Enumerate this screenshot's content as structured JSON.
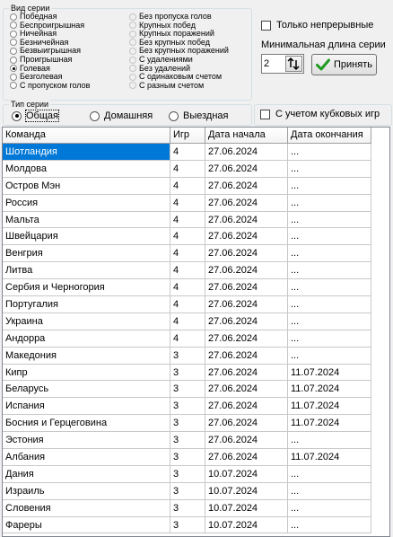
{
  "series_kind": {
    "title": "Вид серии",
    "left_options": [
      {
        "label": "Победная",
        "selected": false
      },
      {
        "label": "Беспроигрышная",
        "selected": false
      },
      {
        "label": "Ничейная",
        "selected": false
      },
      {
        "label": "Безничейная",
        "selected": false
      },
      {
        "label": "Безвыигрышная",
        "selected": false
      },
      {
        "label": "Проигрышная",
        "selected": false
      },
      {
        "label": "Голевая",
        "selected": true
      },
      {
        "label": "Безголевая",
        "selected": false
      },
      {
        "label": "С пропуском голов",
        "selected": false
      }
    ],
    "right_options": [
      {
        "label": "Без пропуска голов",
        "selected": false
      },
      {
        "label": "Крупных побед",
        "selected": false
      },
      {
        "label": "Крупных поражений",
        "selected": false
      },
      {
        "label": "Без крупных побед",
        "selected": false
      },
      {
        "label": "Без крупных поражений",
        "selected": false
      },
      {
        "label": "С удалениями",
        "selected": false
      },
      {
        "label": "Без удалений",
        "selected": false
      },
      {
        "label": "С одинаковым счетом",
        "selected": false
      },
      {
        "label": "С разным счетом",
        "selected": false
      }
    ]
  },
  "continuous_only": {
    "label": "Только непрерывные",
    "checked": false
  },
  "min_length": {
    "label": "Минимальная длина серии",
    "value": "2"
  },
  "accept_button": {
    "label": "Принять",
    "icon": "green-checkmark-icon",
    "icon_color": "#1f9a1f"
  },
  "series_type": {
    "title": "Тип серии",
    "options": [
      {
        "label": "Общая",
        "selected": true
      },
      {
        "label": "Домашняя",
        "selected": false
      },
      {
        "label": "Выездная",
        "selected": false
      }
    ]
  },
  "cup_games": {
    "label": "С учетом кубковых игр",
    "checked": false
  },
  "table": {
    "headers": [
      "Команда",
      "Игр",
      "Дата начала",
      "Дата окончания"
    ],
    "selected_color": "#0078d7",
    "rows": [
      [
        "Шотландия",
        "4",
        "27.06.2024",
        "..."
      ],
      [
        "Молдова",
        "4",
        "27.06.2024",
        "..."
      ],
      [
        "Остров Мэн",
        "4",
        "27.06.2024",
        "..."
      ],
      [
        "Россия",
        "4",
        "27.06.2024",
        "..."
      ],
      [
        "Мальта",
        "4",
        "27.06.2024",
        "..."
      ],
      [
        "Швейцария",
        "4",
        "27.06.2024",
        "..."
      ],
      [
        "Венгрия",
        "4",
        "27.06.2024",
        "..."
      ],
      [
        "Литва",
        "4",
        "27.06.2024",
        "..."
      ],
      [
        "Сербия и Черногория",
        "4",
        "27.06.2024",
        "..."
      ],
      [
        "Португалия",
        "4",
        "27.06.2024",
        "..."
      ],
      [
        "Украина",
        "4",
        "27.06.2024",
        "..."
      ],
      [
        "Андорра",
        "4",
        "27.06.2024",
        "..."
      ],
      [
        "Македония",
        "3",
        "27.06.2024",
        "..."
      ],
      [
        "Кипр",
        "3",
        "27.06.2024",
        "11.07.2024"
      ],
      [
        "Беларусь",
        "3",
        "27.06.2024",
        "11.07.2024"
      ],
      [
        "Испания",
        "3",
        "27.06.2024",
        "11.07.2024"
      ],
      [
        "Босния и Герцеговина",
        "3",
        "27.06.2024",
        "11.07.2024"
      ],
      [
        "Эстония",
        "3",
        "27.06.2024",
        "..."
      ],
      [
        "Албания",
        "3",
        "27.06.2024",
        "11.07.2024"
      ],
      [
        "Дания",
        "3",
        "10.07.2024",
        "..."
      ],
      [
        "Израиль",
        "3",
        "10.07.2024",
        "..."
      ],
      [
        "Словения",
        "3",
        "10.07.2024",
        "..."
      ],
      [
        "Фареры",
        "3",
        "10.07.2024",
        "..."
      ]
    ]
  }
}
